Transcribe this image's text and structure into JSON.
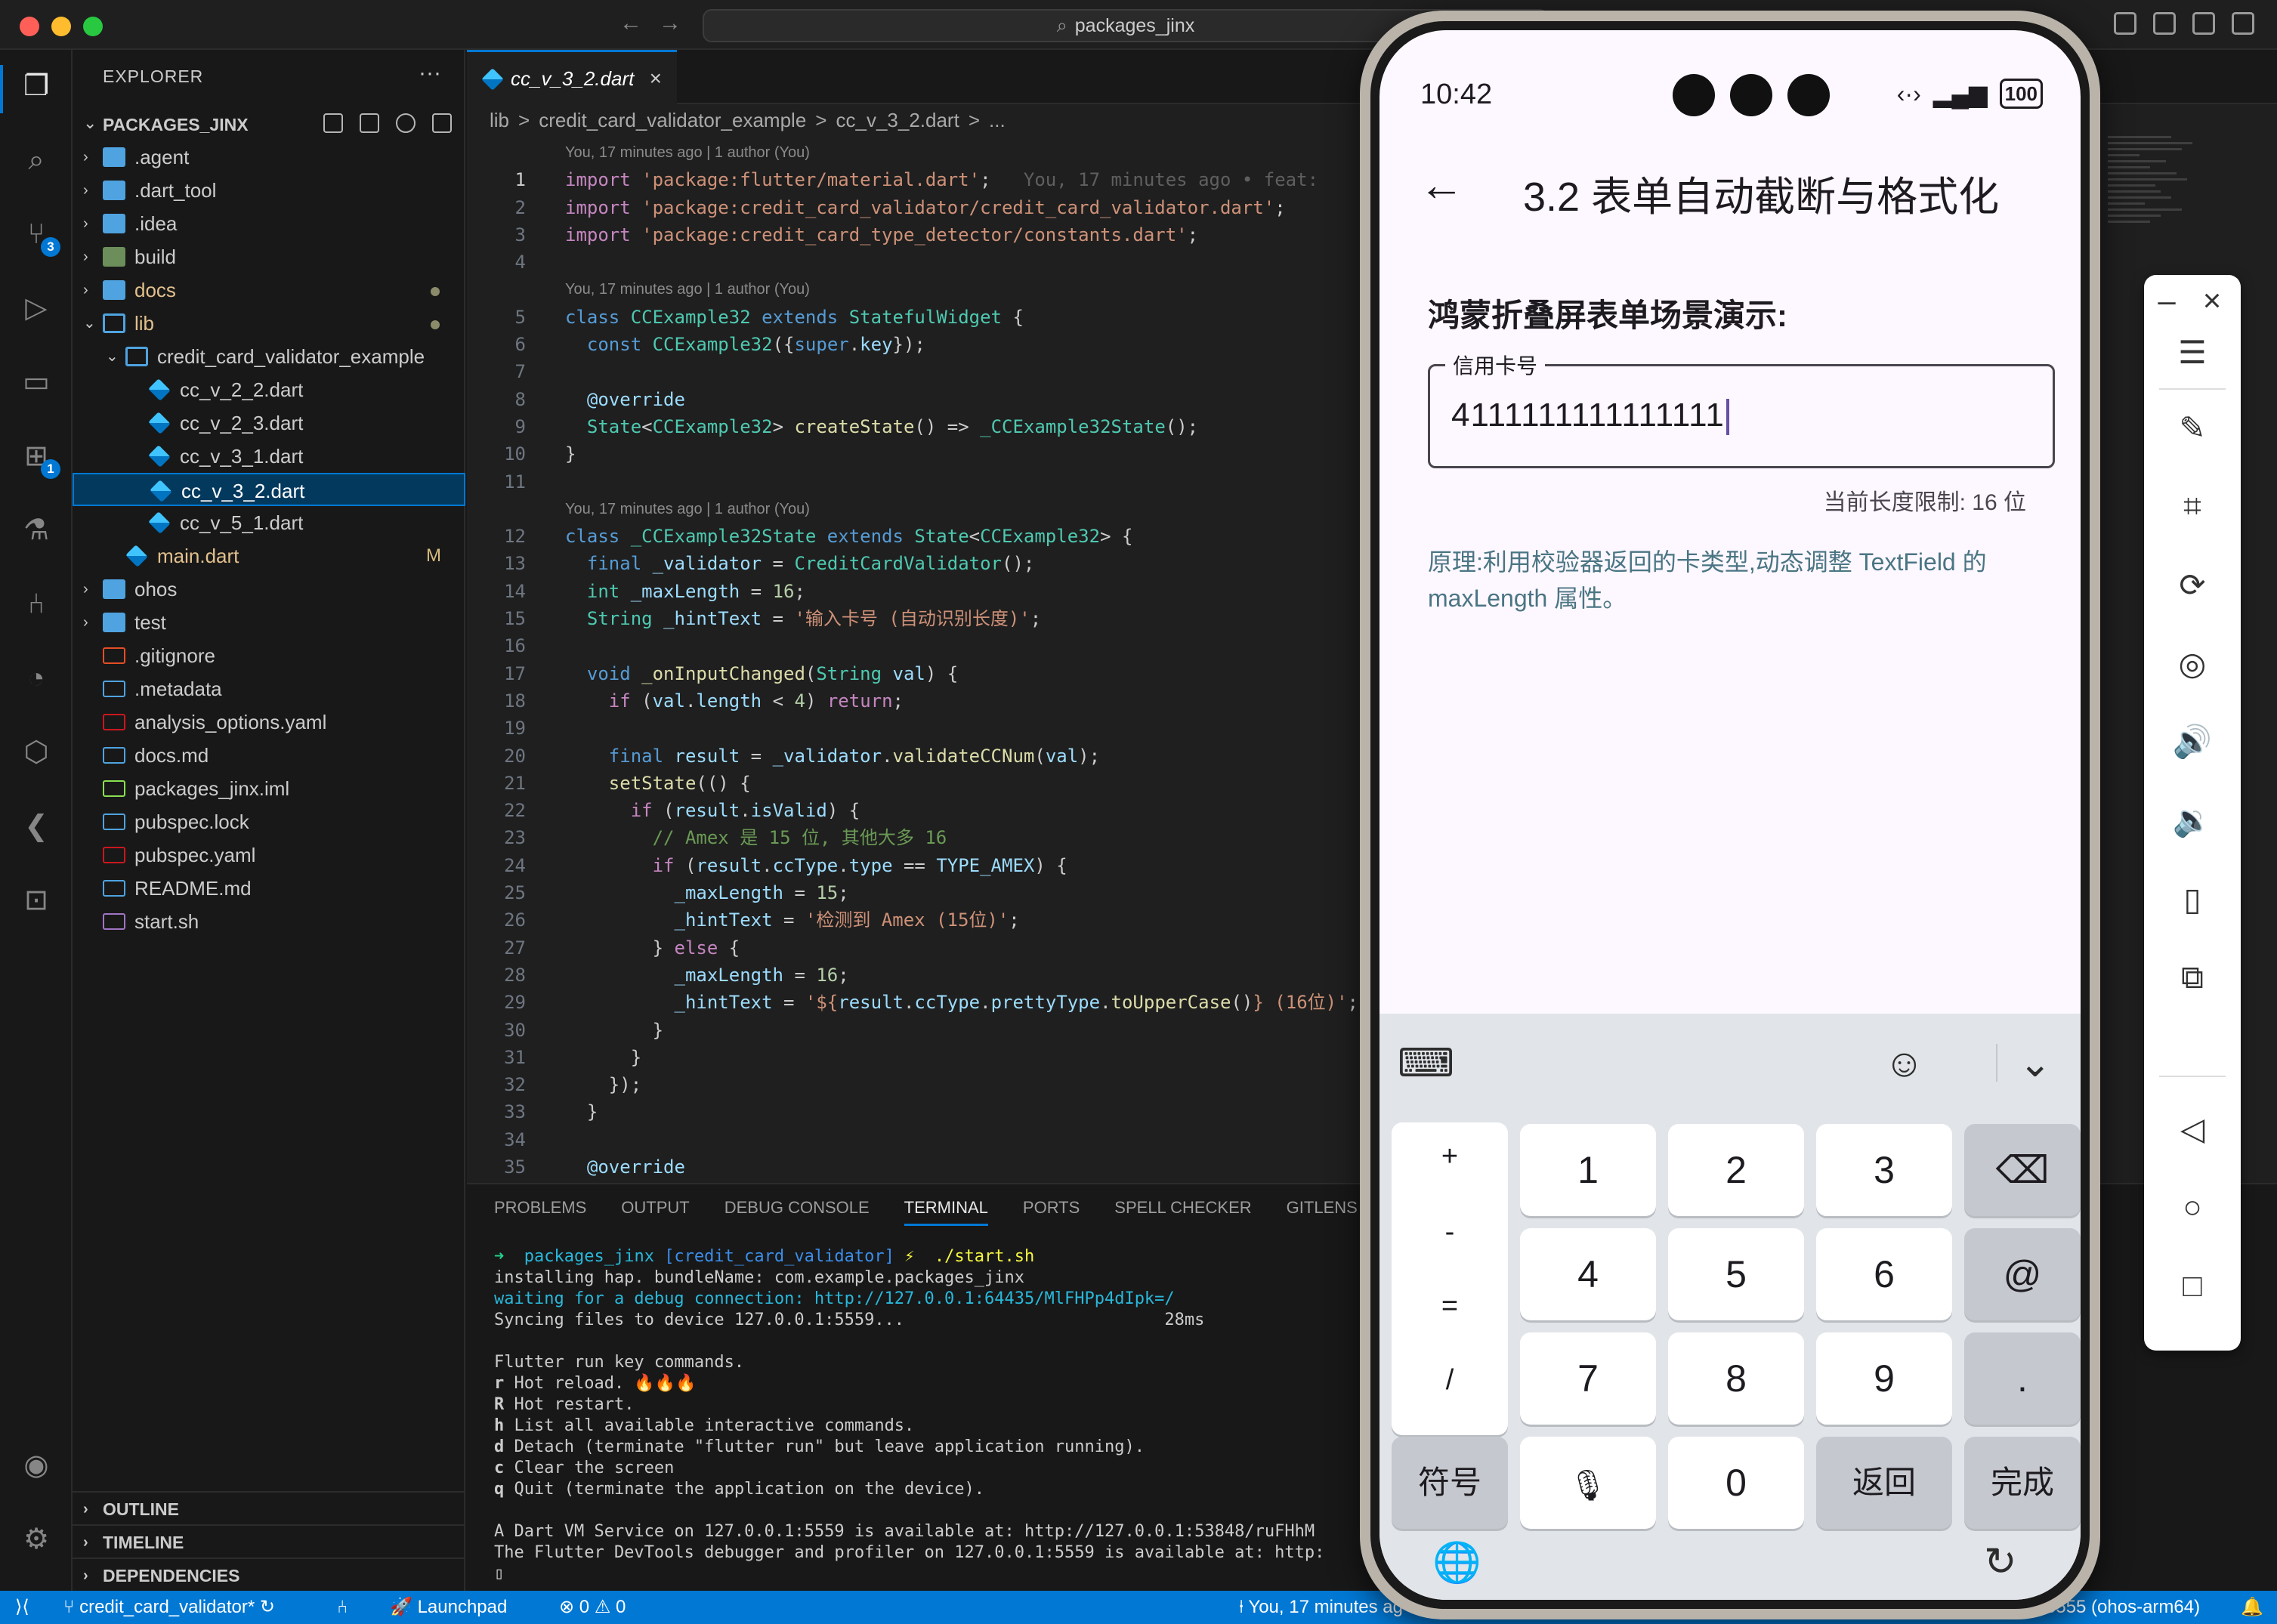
{
  "window": {
    "title_search": "packages_jinx"
  },
  "explorer": {
    "title": "EXPLORER",
    "project": "PACKAGES_JINX",
    "items": [
      {
        "label": ".agent",
        "kind": "folder",
        "depth": 0,
        "expanded": false
      },
      {
        "label": ".dart_tool",
        "kind": "folder",
        "depth": 0,
        "expanded": false
      },
      {
        "label": ".idea",
        "kind": "folder",
        "depth": 0,
        "expanded": false
      },
      {
        "label": "build",
        "kind": "folder-build",
        "depth": 0,
        "expanded": false
      },
      {
        "label": "docs",
        "kind": "folder",
        "depth": 0,
        "expanded": false,
        "dot": true,
        "color": "#e2c08d"
      },
      {
        "label": "lib",
        "kind": "folder-open",
        "depth": 0,
        "expanded": true,
        "dot": true,
        "color": "#e2c08d"
      },
      {
        "label": "credit_card_validator_example",
        "kind": "folder-open",
        "depth": 1,
        "expanded": true
      },
      {
        "label": "cc_v_2_2.dart",
        "kind": "dart",
        "depth": 2
      },
      {
        "label": "cc_v_2_3.dart",
        "kind": "dart",
        "depth": 2
      },
      {
        "label": "cc_v_3_1.dart",
        "kind": "dart",
        "depth": 2
      },
      {
        "label": "cc_v_3_2.dart",
        "kind": "dart",
        "depth": 2,
        "selected": true
      },
      {
        "label": "cc_v_5_1.dart",
        "kind": "dart",
        "depth": 2
      },
      {
        "label": "main.dart",
        "kind": "dart",
        "depth": 1,
        "badge": "M",
        "color": "#e2c08d"
      },
      {
        "label": "ohos",
        "kind": "folder",
        "depth": 0,
        "expanded": false
      },
      {
        "label": "test",
        "kind": "folder",
        "depth": 0,
        "expanded": false
      },
      {
        "label": ".gitignore",
        "kind": "git",
        "depth": 0
      },
      {
        "label": ".metadata",
        "kind": "file",
        "depth": 0
      },
      {
        "label": "analysis_options.yaml",
        "kind": "yaml",
        "depth": 0
      },
      {
        "label": "docs.md",
        "kind": "md",
        "depth": 0
      },
      {
        "label": "packages_jinx.iml",
        "kind": "xml",
        "depth": 0
      },
      {
        "label": "pubspec.lock",
        "kind": "file",
        "depth": 0
      },
      {
        "label": "pubspec.yaml",
        "kind": "yaml",
        "depth": 0
      },
      {
        "label": "README.md",
        "kind": "md",
        "depth": 0
      },
      {
        "label": "start.sh",
        "kind": "sh",
        "depth": 0
      }
    ],
    "sections": [
      "OUTLINE",
      "TIMELINE",
      "DEPENDENCIES"
    ]
  },
  "activity_badges": {
    "scm": "3",
    "extensions": "1"
  },
  "editor": {
    "tab_label": "cc_v_3_2.dart",
    "breadcrumb": [
      "lib",
      ">",
      "credit_card_validator_example",
      ">",
      "cc_v_3_2.dart",
      ">",
      "..."
    ],
    "blame_1": "You, 17 minutes ago | 1 author (You)",
    "blame_2": "You, 17 minutes ago | 1 author (You)",
    "blame_3": "You, 17 minutes ago | 1 author (You)",
    "ghost_text": "You, 17 minutes ago • feat:"
  },
  "panel": {
    "tabs": [
      "PROBLEMS",
      "OUTPUT",
      "DEBUG CONSOLE",
      "TERMINAL",
      "PORTS",
      "SPELL CHECKER",
      "GITLENS"
    ],
    "active_tab": "TERMINAL",
    "terminal": {
      "prompt_dir": "packages_jinx",
      "prompt_branch": "[credit_card_validator]",
      "prompt_cmd": "./start.sh",
      "l1": "installing hap. bundleName: com.example.packages_jinx",
      "l2": "waiting for a debug connection: http://127.0.0.1:64435/MlFHPp4dIpk=/",
      "l3": "Syncing files to device 127.0.0.1:5559...                          28ms",
      "l4": "Flutter run key commands.",
      "k_r": "r",
      "k_r_text": " Hot reload. 🔥🔥🔥",
      "k_R": "R",
      "k_R_text": " Hot restart.",
      "k_h": "h",
      "k_h_text": " List all available interactive commands.",
      "k_d": "d",
      "k_d_text": " Detach (terminate \"flutter run\" but leave application running).",
      "k_c": "c",
      "k_c_text": " Clear the screen",
      "k_q": "q",
      "k_q_text": " Quit (terminate the application on the device).",
      "l5": "A Dart VM Service on 127.0.0.1:5559 is available at: http://127.0.0.1:53848/ruFHhM",
      "l6": "The Flutter DevTools debugger and profiler on 127.0.0.1:5559 is available at: http:",
      "cursor": "▯"
    }
  },
  "statusbar": {
    "branch": "credit_card_validator*",
    "launchpad": "Launchpad",
    "errors": "0",
    "warnings": "0",
    "blame": "You, 17 minutes ag",
    "device": "5555 (ohos-arm64)"
  },
  "phone": {
    "time": "10:42",
    "battery": "100",
    "app_title": "3.2 表单自动截断与格式化",
    "section_heading": "鸿蒙折叠屏表单场景演示:",
    "field_label": "信用卡号",
    "field_value": "4111111111111111",
    "helper_text": "当前长度限制: 16 位",
    "principle_text": "原理:利用校验器返回的卡类型,动态调整 TextField 的 maxLength 属性。",
    "keyboard": {
      "side_keys": [
        "+",
        "-",
        "=",
        "/"
      ],
      "rows": [
        [
          "1",
          "2",
          "3"
        ],
        [
          "4",
          "5",
          "6"
        ],
        [
          "7",
          "8",
          "9"
        ]
      ],
      "right_keys": [
        "⌫",
        "@",
        "."
      ],
      "symbols_key": "符号",
      "zero_key": "0",
      "return_key": "返回",
      "done_key": "完成"
    }
  },
  "emulator_toolbar": {
    "icons": [
      "minimize-icon",
      "close-icon",
      "menu-icon",
      "pen-off-icon",
      "crop-icon",
      "rotate-icon",
      "screenshot-icon",
      "volume-up-icon",
      "volume-down-icon",
      "shake-icon",
      "fold-icon",
      "back-icon",
      "home-icon",
      "recent-icon"
    ]
  },
  "colors": {
    "accent": "#0078d4",
    "phone_background": "#fdf7ff",
    "principle_text": "#4a7583"
  }
}
